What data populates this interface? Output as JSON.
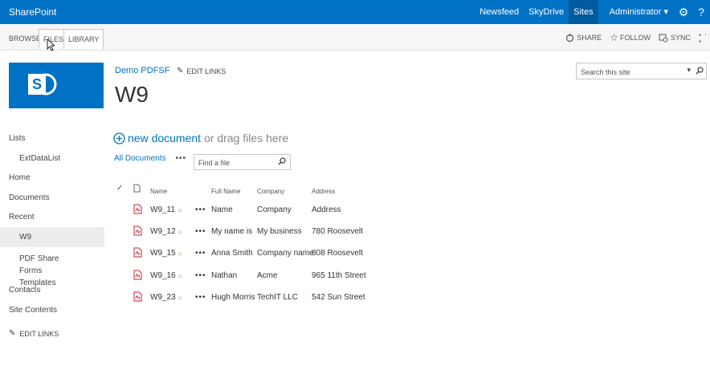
{
  "suite": {
    "brand": "SharePoint",
    "links": [
      "Newsfeed",
      "SkyDrive",
      "Sites"
    ],
    "active_link": "Sites",
    "user": "Administrator"
  },
  "ribbon": {
    "tabs": [
      "BROWSE",
      "FILES",
      "LIBRARY"
    ],
    "actions": {
      "share": "SHARE",
      "follow": "FOLLOW",
      "sync": "SYNC"
    }
  },
  "header": {
    "site_title": "Demo PDFSF",
    "edit_links": "EDIT LINKS",
    "page_title": "W9",
    "search_placeholder": "Search this site"
  },
  "nav": {
    "items": [
      {
        "label": "Lists",
        "level": 0
      },
      {
        "label": "ExtDataList",
        "level": 1
      },
      {
        "label": "Home",
        "level": 0
      },
      {
        "label": "Documents",
        "level": 0
      },
      {
        "label": "Recent",
        "level": 0
      },
      {
        "label": "W9",
        "level": 1,
        "selected": true
      },
      {
        "label": "PDF Share Forms Templates",
        "level": 1
      },
      {
        "label": "Contacts",
        "level": 0
      },
      {
        "label": "Site Contents",
        "level": 0
      }
    ],
    "edit_links": "EDIT LINKS"
  },
  "library": {
    "new_document": "new document",
    "drag_text": "or drag files here",
    "view_name": "All Documents",
    "view_more": "•••",
    "find_placeholder": "Find a file",
    "columns": {
      "name": "Name",
      "full_name": "Full Name",
      "company": "Company",
      "address": "Address"
    },
    "rows": [
      {
        "name": "W9_11",
        "full_name": "Name",
        "company": "Company",
        "address": "Address"
      },
      {
        "name": "W9_12",
        "full_name": "My name is",
        "company": "My business",
        "address": "780 Roosevelt"
      },
      {
        "name": "W9_15",
        "full_name": "Anna Smith",
        "company": "Company name",
        "address": "808 Roosevelt"
      },
      {
        "name": "W9_16",
        "full_name": "Nathan",
        "company": "Acme",
        "address": "965 11th Street"
      },
      {
        "name": "W9_23",
        "full_name": "Hugh Morris",
        "company": "TechIT LLC",
        "address": "542 Sun Street"
      }
    ],
    "new_indicator": "☼",
    "row_menu": "•••"
  },
  "colors": {
    "suite_bar": "#0072c6",
    "accent": "#0072c6",
    "pdf_red": "#c4262e"
  }
}
